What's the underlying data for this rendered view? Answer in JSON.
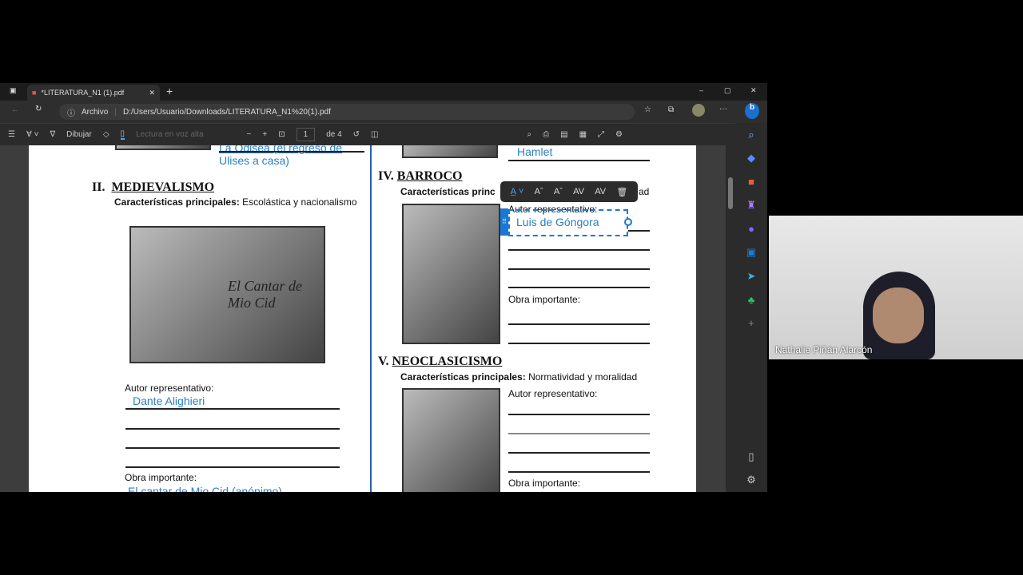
{
  "browser": {
    "tab_title": "*LITERATURA_N1 (1).pdf",
    "new_tab": "+",
    "url_label": "Archivo",
    "url": "D:/Users/Usuario/Downloads/LITERATURA_N1%20(1).pdf",
    "win_min": "–",
    "win_max": "▢",
    "win_close": "✕"
  },
  "pdf_toolbar": {
    "draw": "Dibujar",
    "read_aloud": "Lectura en voz alta",
    "page": "1",
    "page_of": "de 4",
    "zoom_out": "−",
    "zoom_in": "+"
  },
  "document": {
    "top_left_answer_1": "La Odisea (el regreso de",
    "top_left_answer_2": "Ulises a casa)",
    "top_right_answer": "Hamlet",
    "medievalismo": {
      "num": "II.",
      "title": "MEDIEVALISMO",
      "car_label": "Características principales:",
      "car_value": "Escolástica y nacionalismo",
      "autor_label": "Autor representativo:",
      "autor": "Dante Alighieri",
      "obra_label": "Obra importante:",
      "obra": "El cantar de Mio Cid (anónimo)",
      "image_text": "El Cantar de Mio Cid"
    },
    "barroco": {
      "num": "IV.",
      "title": "BARROCO",
      "car_label": "Características princ",
      "car_tail": "ad",
      "autor_label": "Autor representativo:",
      "autor": "Luis de Góngora",
      "obra_label": "Obra importante:"
    },
    "neoclasicismo": {
      "num": "V.",
      "title": "NEOCLASICISMO",
      "car_label": "Características principales:",
      "car_value": "Normatividad y moralidad",
      "autor_label": "Autor representativo:",
      "obra_label": "Obra importante:"
    }
  },
  "format_toolbar": {
    "icons": [
      "text-color-icon",
      "font-increase-icon",
      "font-decrease-icon",
      "spacing-increase-icon",
      "spacing-decrease-icon",
      "delete-icon"
    ]
  },
  "video": {
    "participant": "Nathalie Piñán Alarcón"
  },
  "colors": {
    "accent": "#1a78d4",
    "answer_text": "#2a7fc6"
  }
}
